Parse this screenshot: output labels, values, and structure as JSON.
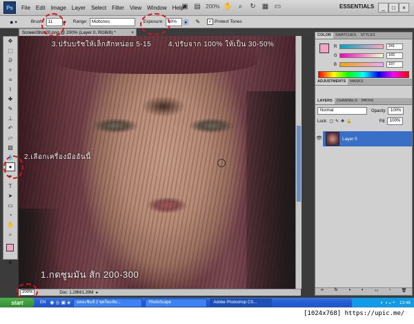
{
  "app": {
    "logo": "Ps",
    "workspace": "ESSENTIALS",
    "zoom_menu": "200%"
  },
  "menu": [
    "File",
    "Edit",
    "Image",
    "Layer",
    "Select",
    "Filter",
    "View",
    "Window",
    "Help"
  ],
  "options": {
    "brush_label": "Brush:",
    "brush_size": "11",
    "range_label": "Range:",
    "range_value": "Midtones",
    "exposure_label": "Exposure:",
    "exposure_value": "50%",
    "protect_tones": "Protect Tones"
  },
  "document": {
    "tab_title": "ScreenShot20.png @ 200% (Layer 0, RGB/8) *",
    "zoom": "200%",
    "doc_info": "Doc: 1.29M/1.29M"
  },
  "annotations": {
    "step1": "1.กดซูมมัน สัก 200-300",
    "step2": "2.เลือกเครื่องมืออันนี้",
    "step3": "3.ปรับบรัชให้เล็กสักหน่อย 5-15",
    "step4": "4.ปรับจาก 100% ให้เป็น 30-50%"
  },
  "panels": {
    "color_tabs": [
      "COLOR",
      "SWATCHES",
      "STYLES"
    ],
    "r_label": "R",
    "g_label": "G",
    "b_label": "B",
    "r": "241",
    "g": "165",
    "b": "197",
    "adjustment_tabs": [
      "ADJUSTMENTS",
      "MASKS"
    ],
    "layer_tabs": [
      "LAYERS",
      "CHANNELS",
      "PATHS"
    ],
    "blend_mode": "Normal",
    "opacity_label": "Opacity:",
    "opacity": "100%",
    "lock_label": "Lock:",
    "fill_label": "Fill:",
    "fill": "100%",
    "layer_name": "Layer 0"
  },
  "taskbar": {
    "start": "start",
    "lang": "EN",
    "items": [
      "ผลอะชิมส์ 2 ชุดใยแห้ม...",
      "PhotoScape",
      "Adobe Photoshop CS..."
    ],
    "clock": "13:46"
  },
  "watermark": "[1024x768] https://upic.me/",
  "colors": {
    "accent": "#3a6fc7",
    "foreground": "#f1a5c5",
    "highlight": "#e01010"
  }
}
